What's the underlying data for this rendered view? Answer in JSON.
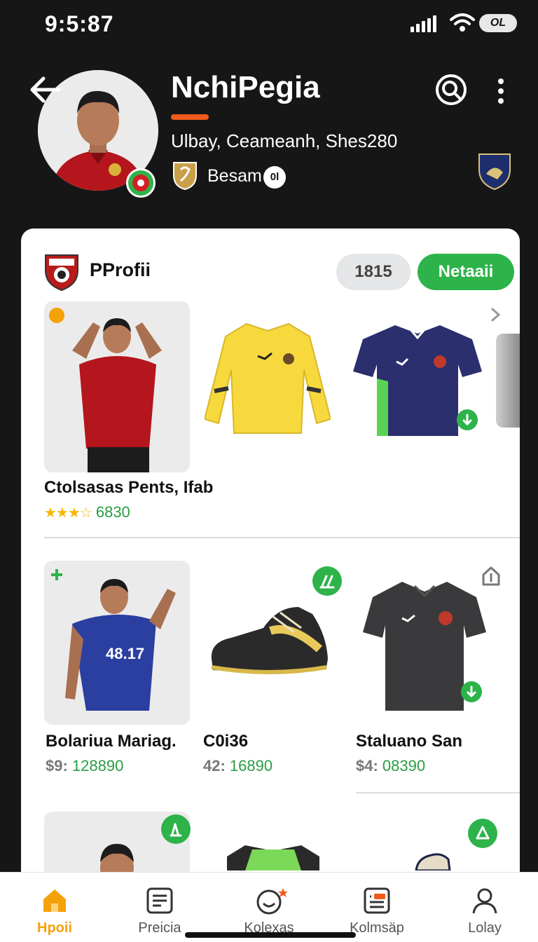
{
  "status_bar": {
    "time": "9:5:87",
    "battery": "OL"
  },
  "header": {
    "title": "NchiPegia",
    "subtitle": "Ulbay, Ceameanh, Shes280",
    "club_name": "Besam",
    "club_count": "0l",
    "accent_color": "#f05a1a"
  },
  "card": {
    "title": "PProfii",
    "count_pill": "1815",
    "action_button": "Netaaii",
    "brand_color": "#2db34a"
  },
  "products": {
    "row1": {
      "title": "Ctolsasas Pents, Ifab",
      "stars": "★★★☆",
      "rating_value": "6830",
      "rating": 3.5
    },
    "row2": [
      {
        "title": "Bolariua Mariag.",
        "currency": "$9:",
        "price": "128890"
      },
      {
        "title": "C0i36",
        "currency": "42:",
        "price": "16890"
      },
      {
        "title": "Staluano San",
        "currency": "$4:",
        "price": "08390"
      }
    ]
  },
  "bottom_nav": {
    "items": [
      {
        "label": "Hpoii",
        "icon": "home-icon",
        "active": true
      },
      {
        "label": "Preicia",
        "icon": "list-icon",
        "active": false
      },
      {
        "label": "Kolexas",
        "icon": "smiley-icon",
        "active": false
      },
      {
        "label": "Kolmsäp",
        "icon": "grid-icon",
        "active": false
      },
      {
        "label": "Lolay",
        "icon": "profile-icon",
        "active": false
      }
    ],
    "active_color": "#f5a10a"
  }
}
